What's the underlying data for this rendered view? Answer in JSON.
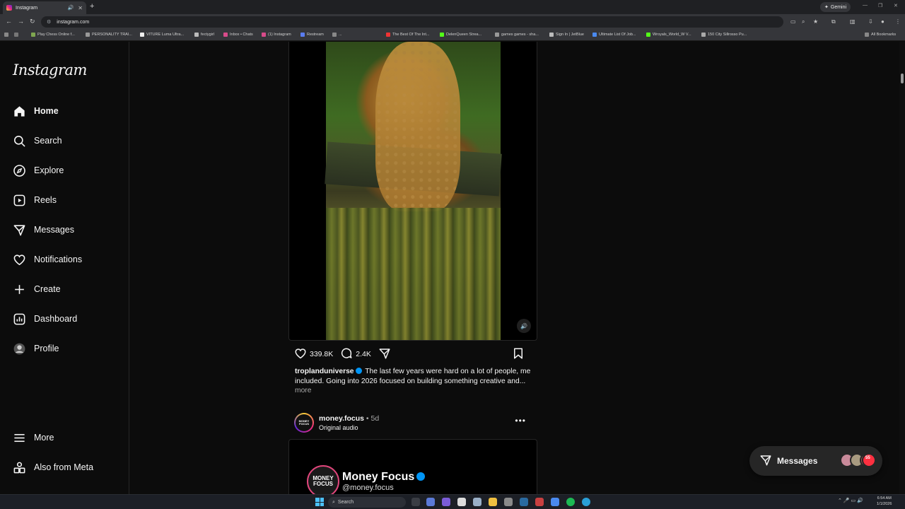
{
  "browser": {
    "tab_title": "Instagram",
    "url": "instagram.com",
    "gemini_label": "Gemini",
    "bookmarks": [
      "Play Chess Online f...",
      "PERSONALITY TRAI...",
      "VITURE Luma Ultra...",
      "fectygirl",
      "Inbox • Chats",
      "(1) Instagram",
      "Restream",
      "...",
      "The Best Of The Int...",
      "DelenQueen Strea...",
      "games games - sha...",
      "Sign In | JetBlue",
      "Ultimate List Of Job...",
      "Wroyals_World_W V...",
      "150 City Sillrosso Pu..."
    ],
    "all_bookmarks": "All Bookmarks"
  },
  "sidebar": {
    "logo": "Instagram",
    "items": [
      {
        "label": "Home",
        "icon": "home-icon"
      },
      {
        "label": "Search",
        "icon": "search-icon"
      },
      {
        "label": "Explore",
        "icon": "compass-icon"
      },
      {
        "label": "Reels",
        "icon": "reels-icon"
      },
      {
        "label": "Messages",
        "icon": "send-icon"
      },
      {
        "label": "Notifications",
        "icon": "heart-icon"
      },
      {
        "label": "Create",
        "icon": "plus-icon"
      },
      {
        "label": "Dashboard",
        "icon": "chart-icon"
      },
      {
        "label": "Profile",
        "icon": "avatar-icon"
      }
    ],
    "more": "More",
    "also_from_meta": "Also from Meta"
  },
  "post1": {
    "likes": "339.8K",
    "comments": "2.4K",
    "username": "troplanduniverse",
    "caption": "The last few years were hard on a lot of people, me included. Going into 2026 focused on building something creative and...",
    "more": "more"
  },
  "post2": {
    "username": "money.focus",
    "time": "5d",
    "audio": "Original audio",
    "avatar_text": "MONEY FOCUS",
    "media_name": "Money Focus",
    "media_handle": "@money.focus"
  },
  "messages_pill": {
    "label": "Messages",
    "badge": "55"
  },
  "taskbar": {
    "search": "Search",
    "time": "6:54 AM",
    "date": "1/1/2026"
  }
}
